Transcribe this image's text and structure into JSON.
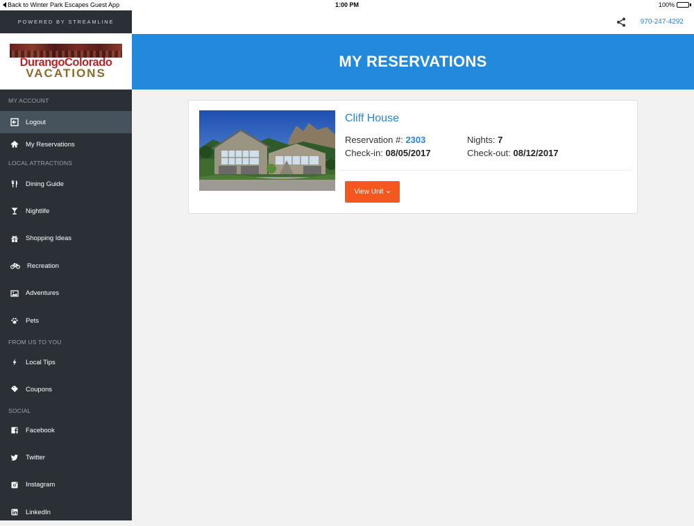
{
  "status_bar": {
    "back_label": "Back to Winter Park Escapes Guest App",
    "time": "1:00 PM",
    "battery": "100%"
  },
  "sidebar": {
    "powered_by": "POWERED BY STREAMLINE",
    "logo": {
      "line1": "DurangoColorado",
      "line2": "VACATIONS"
    },
    "sections": {
      "my_account": "MY ACCOUNT",
      "local_attractions": "LOCAL ATTRACTIONS",
      "from_us": "FROM US TO YOU",
      "social": "SOCIAL"
    },
    "items": {
      "logout": {
        "label": "Logout",
        "icon": "logout-icon"
      },
      "my_reservations": {
        "label": "My Reservations",
        "icon": "home-icon"
      },
      "dining": {
        "label": "Dining Guide",
        "icon": "utensils-icon"
      },
      "nightlife": {
        "label": "Nightlife",
        "icon": "cocktail-icon"
      },
      "shopping": {
        "label": "Shopping Ideas",
        "icon": "gift-icon"
      },
      "recreation": {
        "label": "Recreation",
        "icon": "bicycle-icon"
      },
      "adventures": {
        "label": "Adventures",
        "icon": "image-icon"
      },
      "pets": {
        "label": "Pets",
        "icon": "paw-icon"
      },
      "local_tips": {
        "label": "Local Tips",
        "icon": "bolt-icon"
      },
      "coupons": {
        "label": "Coupons",
        "icon": "tag-icon"
      },
      "facebook": {
        "label": "Facebook",
        "icon": "facebook-icon"
      },
      "twitter": {
        "label": "Twitter",
        "icon": "twitter-icon"
      },
      "instagram": {
        "label": "Instagram",
        "icon": "instagram-icon"
      },
      "linkedin": {
        "label": "LinkedIn",
        "icon": "linkedin-icon"
      }
    }
  },
  "topbar": {
    "phone": "970-247-4292",
    "share_icon": "share-icon"
  },
  "header": {
    "title": "MY RESERVATIONS"
  },
  "reservation": {
    "property_name": "Cliff House",
    "reservation_label": "Reservation #:",
    "reservation_number": "2303",
    "nights_label": "Nights:",
    "nights": "7",
    "checkin_label": "Check-in:",
    "checkin": "08/05/2017",
    "checkout_label": "Check-out:",
    "checkout": "08/12/2017",
    "view_button": "View Unit"
  },
  "colors": {
    "header_blue": "#2289dc",
    "link_blue": "#2a86d4",
    "button_orange": "#f5581e",
    "sidebar_bg": "#2a3036",
    "sidebar_active": "#47535c"
  }
}
